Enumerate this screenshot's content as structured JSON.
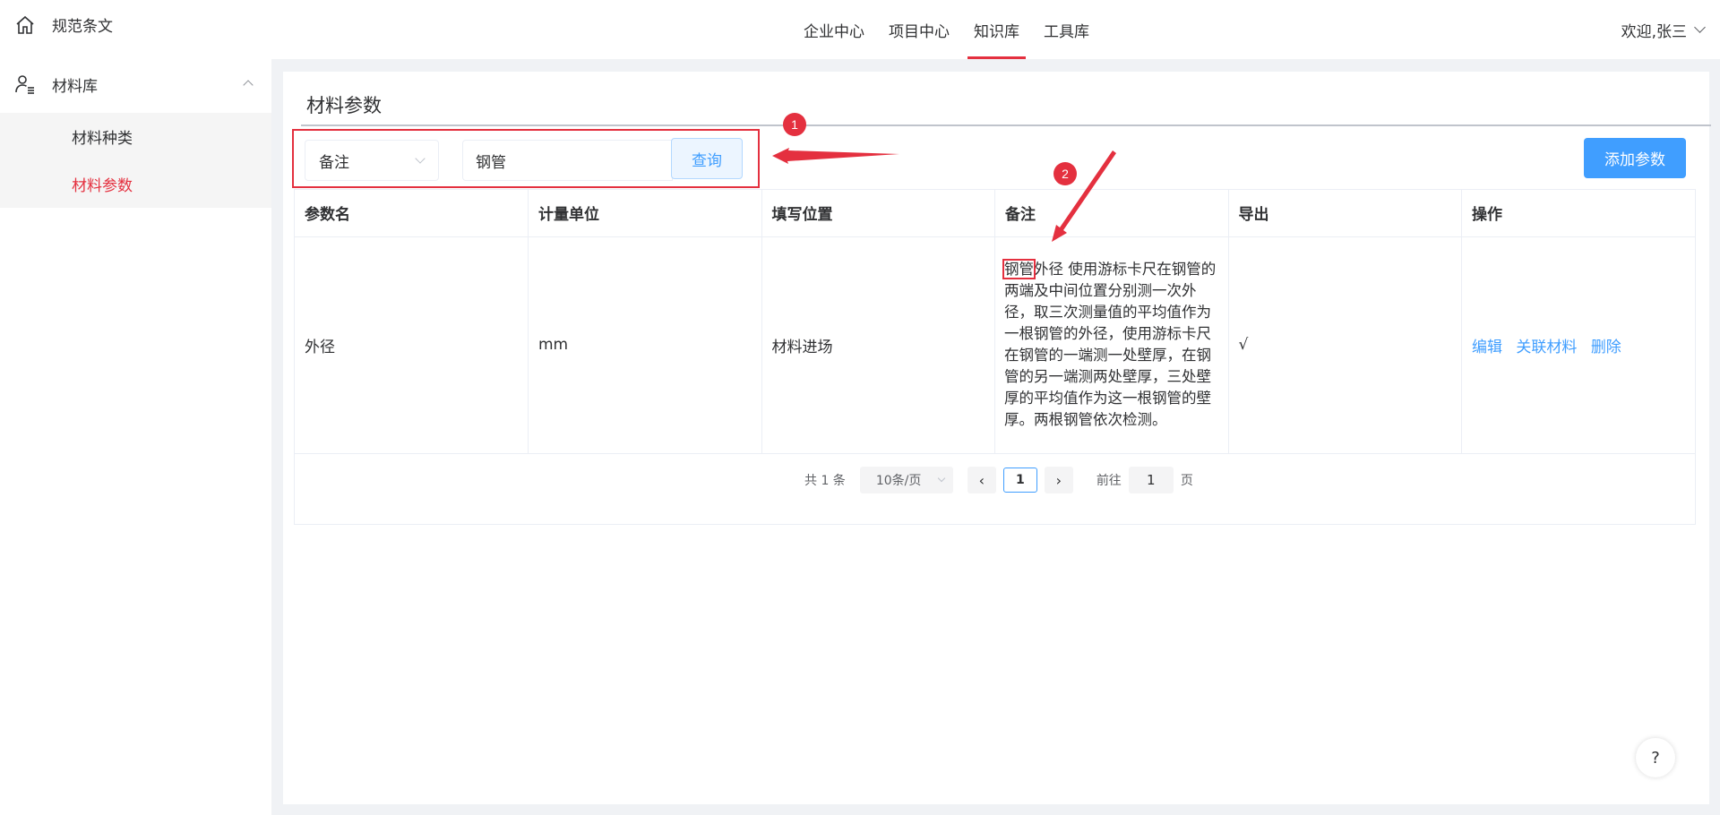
{
  "sidebar": {
    "top_item": "规范条文",
    "group": "材料库",
    "sub_items": [
      {
        "label": "材料种类"
      },
      {
        "label": "材料参数"
      }
    ]
  },
  "topnav": {
    "items": [
      {
        "label": "企业中心"
      },
      {
        "label": "项目中心"
      },
      {
        "label": "知识库"
      },
      {
        "label": "工具库"
      }
    ],
    "active": "知识库",
    "user": "欢迎,张三"
  },
  "page": {
    "title": "材料参数",
    "filter_select": "备注",
    "search_value": "钢管",
    "query_button": "查询",
    "add_button": "添加参数"
  },
  "table": {
    "headers": [
      "参数名",
      "计量单位",
      "填写位置",
      "备注",
      "导出",
      "操作"
    ],
    "rows": [
      {
        "name": "外径",
        "unit": "mm",
        "position": "材料进场",
        "note_highlight": "钢管",
        "note_rest": "外径 使用游标卡尺在钢管的两端及中间位置分别测一次外径，取三次测量值的平均值作为一根钢管的外径，使用游标卡尺在钢管的一端测一处壁厚，在钢管的另一端测两处壁厚，三处壁厚的平均值作为这一根钢管的壁厚。两根钢管依次检测。",
        "export": "√",
        "actions": [
          "编辑",
          "关联材料",
          "删除"
        ]
      }
    ]
  },
  "pagination": {
    "total": "共 1 条",
    "page_size": "10条/页",
    "prev": "‹",
    "next": "›",
    "current": "1",
    "goto_label": "前往",
    "goto_value": "1",
    "goto_suffix": "页"
  },
  "annotations": {
    "badge1": "1",
    "badge2": "2"
  },
  "help": "?",
  "colors": {
    "accent_red": "#e4303f",
    "primary_blue": "#409eff"
  }
}
